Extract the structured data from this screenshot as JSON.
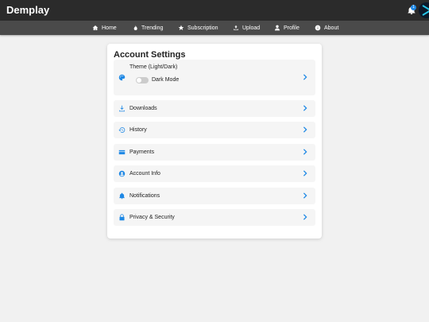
{
  "app": {
    "title": "Demplay"
  },
  "header": {
    "notification_count": "1"
  },
  "nav": {
    "items": [
      {
        "label": "Home",
        "icon": "home-icon"
      },
      {
        "label": "Trending",
        "icon": "fire-icon"
      },
      {
        "label": "Subscription",
        "icon": "star-icon"
      },
      {
        "label": "Upload",
        "icon": "upload-icon"
      },
      {
        "label": "Profile",
        "icon": "user-icon"
      },
      {
        "label": "About",
        "icon": "info-icon"
      }
    ]
  },
  "settings": {
    "title": "Account Settings",
    "theme": {
      "label": "Theme (Light/Dark)",
      "toggle_label": "Dark Mode",
      "enabled": false
    },
    "items": [
      {
        "label": "Downloads",
        "icon": "download-icon"
      },
      {
        "label": "History",
        "icon": "history-icon"
      },
      {
        "label": "Payments",
        "icon": "credit-card-icon"
      },
      {
        "label": "Account Info",
        "icon": "user-circle-icon"
      },
      {
        "label": "Notifications",
        "icon": "bell-icon"
      },
      {
        "label": "Privacy & Security",
        "icon": "lock-icon"
      }
    ]
  },
  "colors": {
    "accent": "#1e88e5",
    "topbar": "#2b2b2b",
    "navbar": "#4a4a4a",
    "row_bg": "#f5f5f5"
  }
}
